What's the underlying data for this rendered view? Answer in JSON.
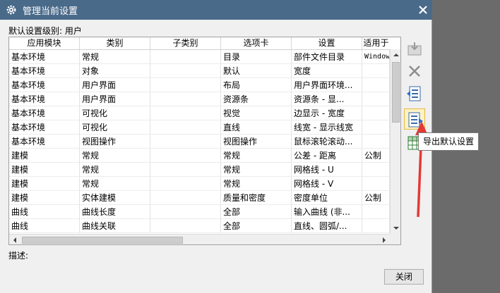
{
  "dialog": {
    "title": "管理当前设置",
    "level_label": "默认设置级别: 用户",
    "description_label": "描述:",
    "close_button": "关闭",
    "tooltip": "导出默认设置"
  },
  "table": {
    "columns": [
      "应用模块",
      "类别",
      "子类别",
      "选项卡",
      "设置",
      "适用于"
    ],
    "rows": [
      [
        "基本环境",
        "常规",
        "",
        "目录",
        "部件文件目录",
        "Windows"
      ],
      [
        "基本环境",
        "对象",
        "",
        "默认",
        "宽度",
        ""
      ],
      [
        "基本环境",
        "用户界面",
        "",
        "布局",
        "用户界面环境...",
        ""
      ],
      [
        "基本环境",
        "用户界面",
        "",
        "资源条",
        "资源条 - 显...",
        ""
      ],
      [
        "基本环境",
        "可视化",
        "",
        "视觉",
        "边显示 - 宽度",
        ""
      ],
      [
        "基本环境",
        "可视化",
        "",
        "直线",
        "线宽 - 显示线宽",
        ""
      ],
      [
        "基本环境",
        "视图操作",
        "",
        "视图操作",
        "鼠标滚轮滚动...",
        ""
      ],
      [
        "建模",
        "常规",
        "",
        "常规",
        "公差 - 距离",
        "公制"
      ],
      [
        "建模",
        "常规",
        "",
        "常规",
        "网格线 - U",
        ""
      ],
      [
        "建模",
        "常规",
        "",
        "常规",
        "网格线 - V",
        ""
      ],
      [
        "建模",
        "实体建模",
        "",
        "质量和密度",
        "密度单位",
        "公制"
      ],
      [
        "曲线",
        "曲线长度",
        "",
        "全部",
        "输入曲线 (非...",
        ""
      ],
      [
        "曲线",
        "曲线关联",
        "",
        "全部",
        "直线、圆弧/...",
        ""
      ]
    ]
  },
  "icons": {
    "title": "gear-icon",
    "close": "close-icon",
    "tools": [
      "import-icon",
      "delete-icon",
      "import-settings-icon",
      "export-settings-icon",
      "spreadsheet-icon"
    ]
  },
  "colors": {
    "titlebar": "#4a6a8a",
    "annotation_arrow": "#e53935",
    "highlight": "#fdf3c4"
  }
}
